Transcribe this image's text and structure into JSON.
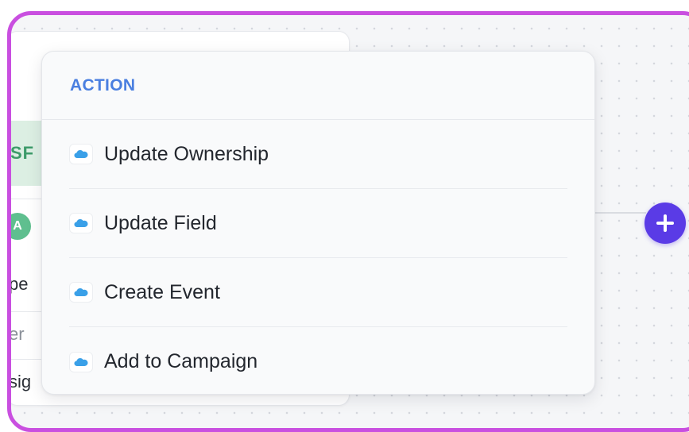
{
  "background_card": {
    "header_fragment": "SF",
    "avatar_letter": "A",
    "rows": [
      "pe",
      "er",
      "sig"
    ]
  },
  "menu": {
    "section_title": "ACTION",
    "items": [
      {
        "label": "Update Ownership",
        "icon": "salesforce-cloud-icon"
      },
      {
        "label": "Update Field",
        "icon": "salesforce-cloud-icon"
      },
      {
        "label": "Create Event",
        "icon": "salesforce-cloud-icon"
      },
      {
        "label": "Add to Campaign",
        "icon": "salesforce-cloud-icon"
      }
    ]
  },
  "colors": {
    "frame_border": "#c94fe0",
    "section_title": "#4a7fe0",
    "add_button": "#5a3be6",
    "salesforce_icon": "#3aa0e8"
  }
}
